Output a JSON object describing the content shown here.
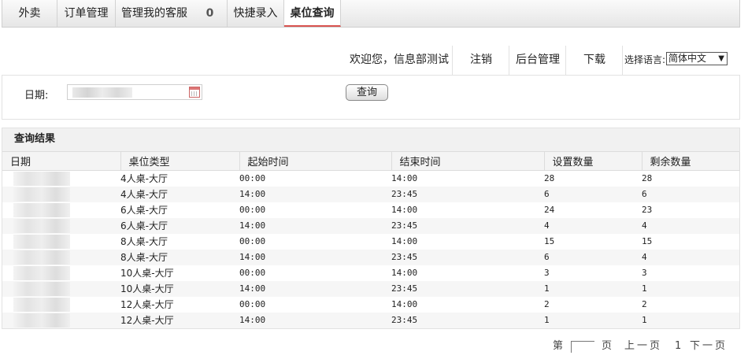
{
  "tabs": [
    {
      "label": "外卖"
    },
    {
      "label": "订单管理"
    },
    {
      "label": "管理我的客服"
    },
    {
      "label": "0"
    },
    {
      "label": "快捷录入"
    },
    {
      "label": "桌位查询"
    }
  ],
  "userbar": {
    "welcome": "欢迎您，信息部测试",
    "logout": "注销",
    "admin": "后台管理",
    "download": "下载",
    "lang_label": "选择语言:",
    "lang_value": "简体中文"
  },
  "form": {
    "date_label": "日期:",
    "query_button": "查询"
  },
  "results": {
    "title": "查询结果",
    "headers": [
      "日期",
      "桌位类型",
      "起始时间",
      "结束时间",
      "设置数量",
      "剩余数量"
    ],
    "rows": [
      {
        "type": "4人桌-大厅",
        "start": "00:00",
        "end": "14:00",
        "set": "28",
        "left": "28"
      },
      {
        "type": "4人桌-大厅",
        "start": "14:00",
        "end": "23:45",
        "set": "6",
        "left": "6"
      },
      {
        "type": "6人桌-大厅",
        "start": "00:00",
        "end": "14:00",
        "set": "24",
        "left": "23"
      },
      {
        "type": "6人桌-大厅",
        "start": "14:00",
        "end": "23:45",
        "set": "4",
        "left": "4"
      },
      {
        "type": "8人桌-大厅",
        "start": "00:00",
        "end": "14:00",
        "set": "15",
        "left": "15"
      },
      {
        "type": "8人桌-大厅",
        "start": "14:00",
        "end": "23:45",
        "set": "6",
        "left": "4"
      },
      {
        "type": "10人桌-大厅",
        "start": "00:00",
        "end": "14:00",
        "set": "3",
        "left": "3"
      },
      {
        "type": "10人桌-大厅",
        "start": "14:00",
        "end": "23:45",
        "set": "1",
        "left": "1"
      },
      {
        "type": "12人桌-大厅",
        "start": "00:00",
        "end": "14:00",
        "set": "2",
        "left": "2"
      },
      {
        "type": "12人桌-大厅",
        "start": "14:00",
        "end": "23:45",
        "set": "1",
        "left": "1"
      }
    ]
  },
  "pager": {
    "page_prefix": "第",
    "page_suffix": "页",
    "prev": "上一页",
    "current": "1",
    "next": "下一页"
  }
}
